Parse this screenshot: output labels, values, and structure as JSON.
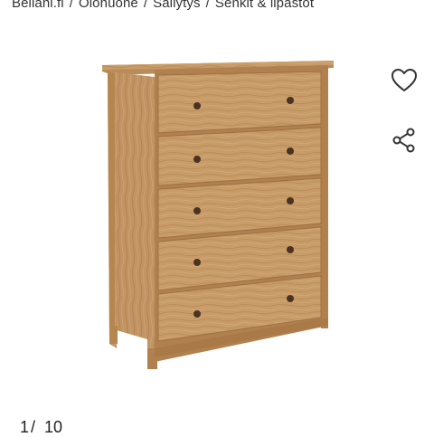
{
  "breadcrumb": {
    "items": [
      "Beliani.fi",
      "Olohuone",
      "Säilytys",
      "Senkit & lipastot"
    ],
    "separator": "/"
  },
  "product": {
    "image_icon": "wooden-chest-of-drawers",
    "drawer_count": 5
  },
  "actions": {
    "favorite_icon": "heart-outline-icon",
    "share_icon": "share-icon"
  },
  "gallery": {
    "current": "1",
    "separator": "/",
    "total": "10"
  },
  "colors": {
    "wood": "#c69a66",
    "wood_dark": "#a97a48",
    "knob": "#4a3322",
    "icon": "#333333"
  }
}
